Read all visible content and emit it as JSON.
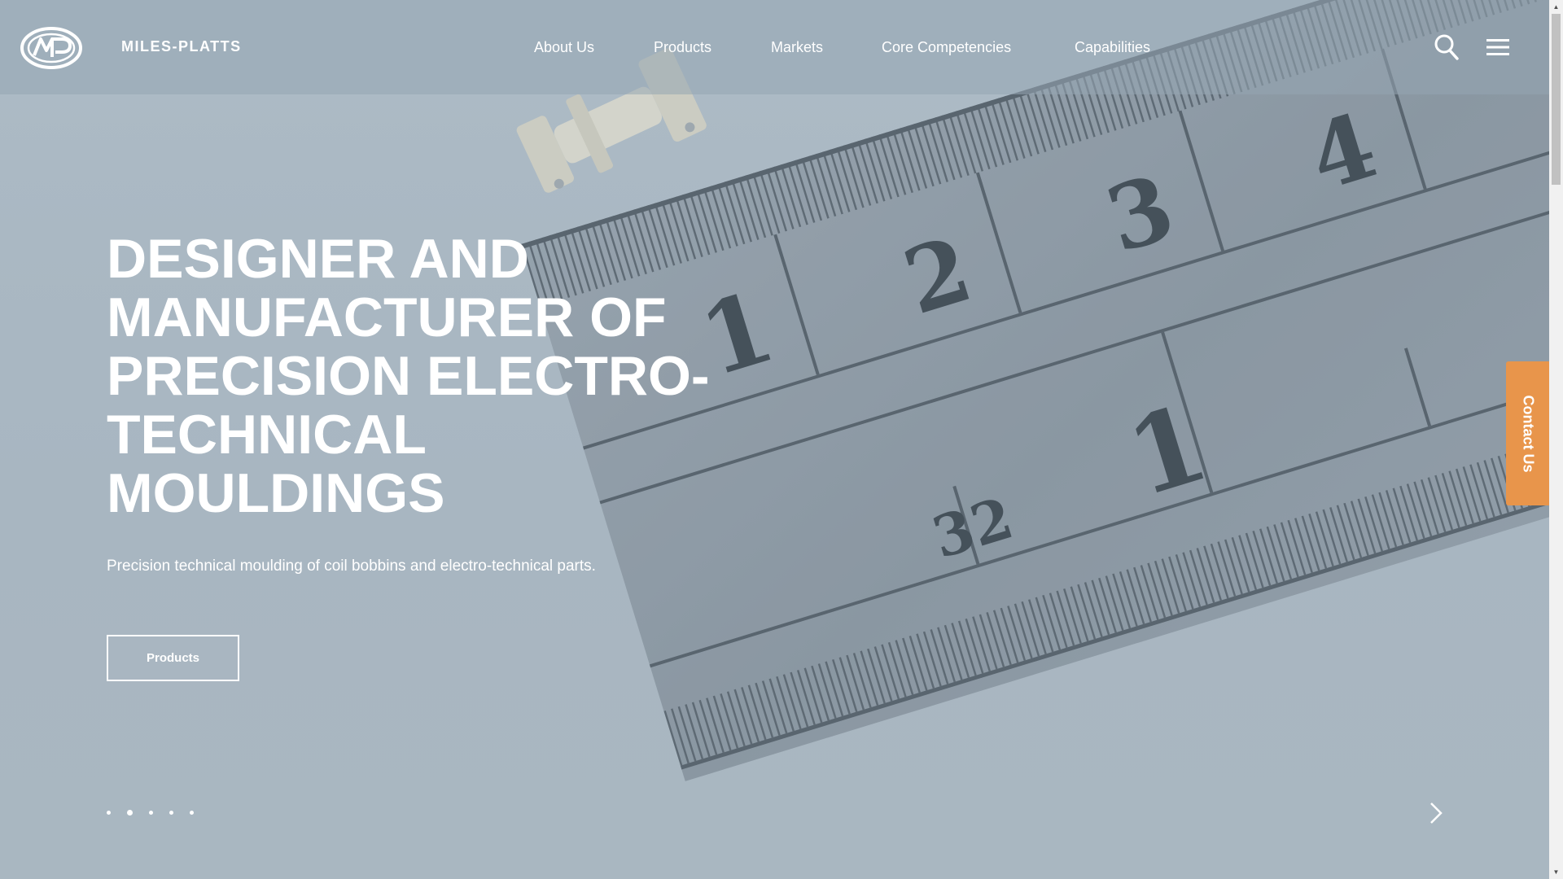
{
  "header": {
    "brand": "MILES-PLATTS",
    "logo_icon": "mp-logo-icon",
    "nav": [
      {
        "label": "About Us"
      },
      {
        "label": "Products"
      },
      {
        "label": "Markets"
      },
      {
        "label": "Core Competencies"
      },
      {
        "label": "Capabilities"
      }
    ],
    "search_icon": "search-icon",
    "menu_icon": "hamburger-menu-icon"
  },
  "hero": {
    "headline_lines": [
      "DESIGNER AND",
      "MANUFACTURER OF",
      "PRECISION ELECTRO-",
      "TECHNICAL",
      "MOULDINGS"
    ],
    "subtext": "Precision technical moulding of coil bobbins and electro-technical parts.",
    "cta_label": "Products",
    "slides_count": 5,
    "active_slide": 2,
    "ruler_numbers_top": [
      "1",
      "2",
      "3",
      "4"
    ],
    "ruler_numbers_bottom": [
      "32",
      "1"
    ]
  },
  "contact_tab": {
    "label": "Contact Us"
  },
  "colors": {
    "accent_orange": "#e8954b",
    "header_bg": "#96a6b2",
    "text": "#ffffff"
  }
}
